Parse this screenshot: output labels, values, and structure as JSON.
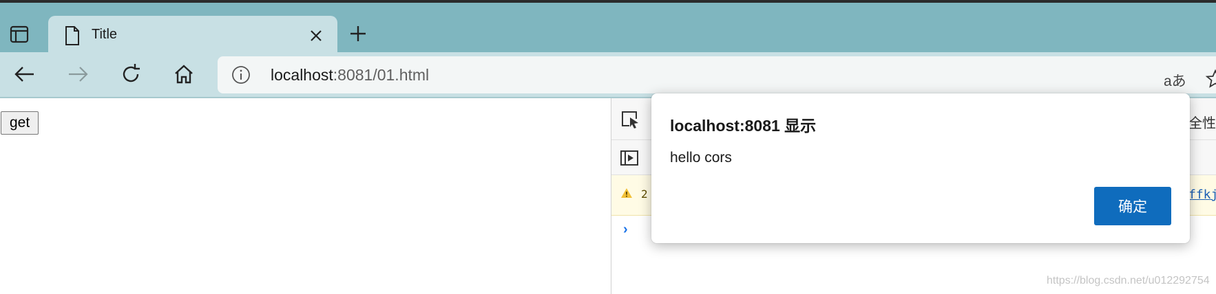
{
  "browser": {
    "tab_title": "Title",
    "url_host": "localhost",
    "url_rest": ":8081/01.html",
    "read_aloud_label": "aあ"
  },
  "page": {
    "get_button_label": "get"
  },
  "devtools": {
    "top_right_text": "全性",
    "warning_text_prefix": "2",
    "warning_link_text": "ffkj",
    "prompt_symbol": "›"
  },
  "dialog": {
    "title": "localhost:8081 显示",
    "message": "hello cors",
    "ok_label": "确定"
  },
  "watermark": "https://blog.csdn.net/u012292754"
}
